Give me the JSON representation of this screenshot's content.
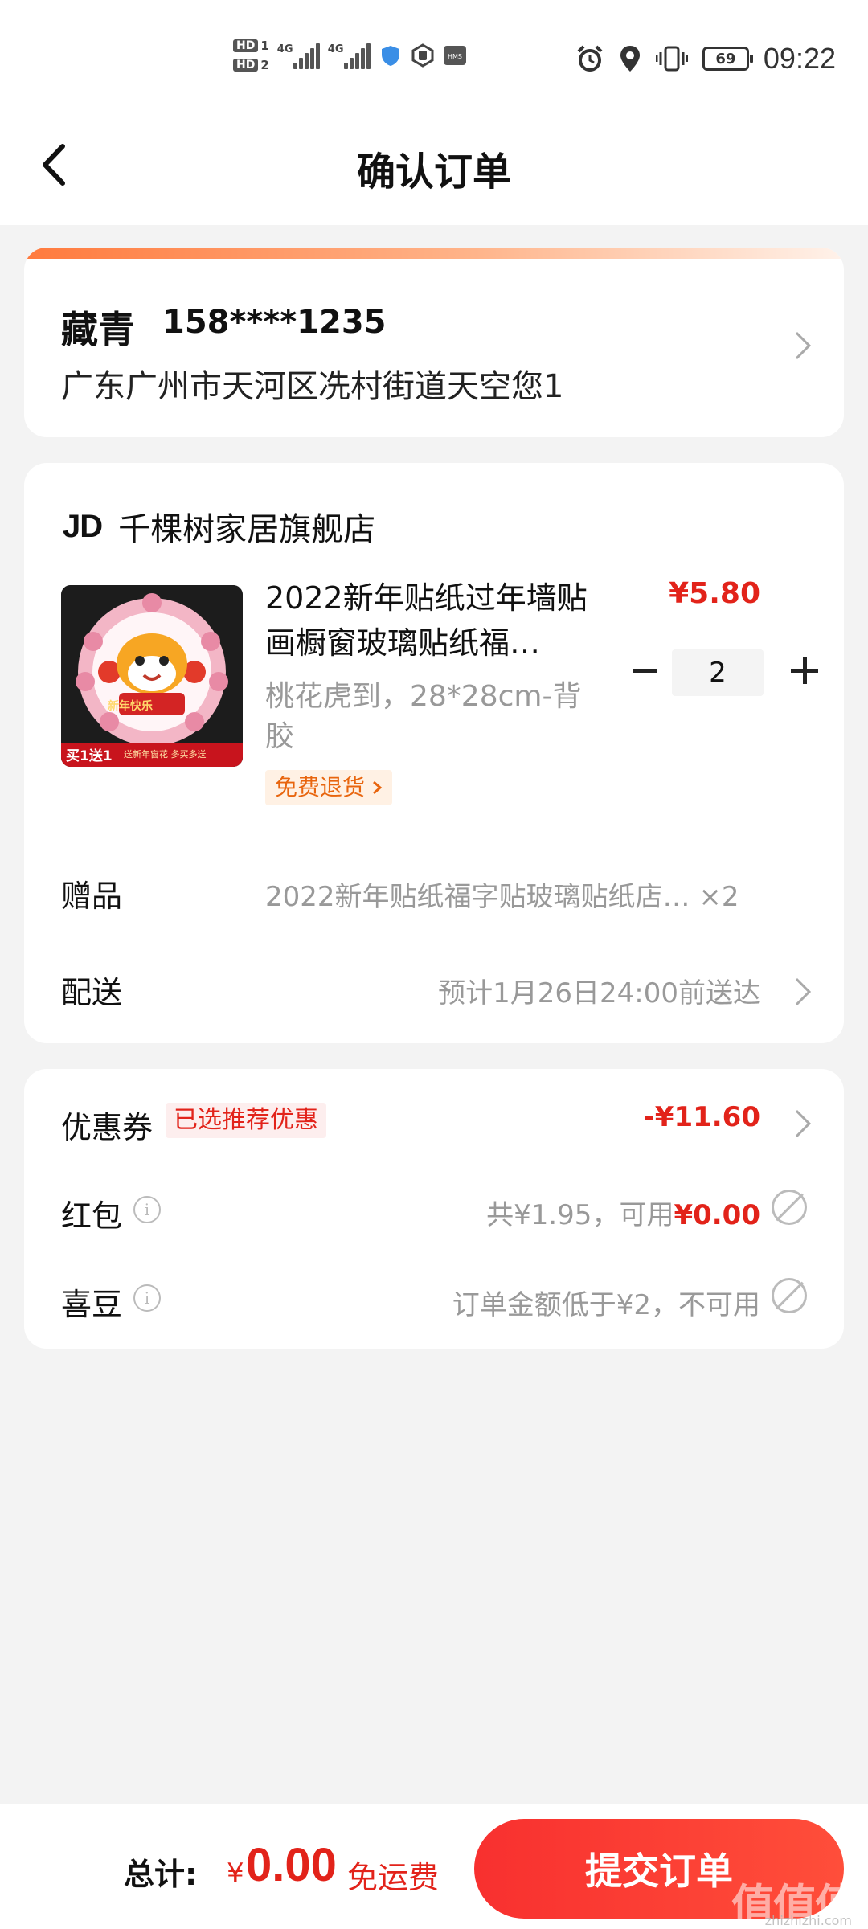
{
  "status_bar": {
    "hd1": "HD",
    "hd1_num": "1",
    "hd2": "HD",
    "hd2_num": "2",
    "net1": "4G",
    "net2": "4G",
    "battery": "69",
    "time": "09:22"
  },
  "nav": {
    "title": "确认订单"
  },
  "address": {
    "name": "藏青",
    "phone": "158****1235",
    "detail": "广东广州市天河区冼村街道天空您1"
  },
  "store": {
    "logo": "JD",
    "name": "千棵树家居旗舰店",
    "product": {
      "image_caption": "新年快乐",
      "image_badge": "买1送1",
      "image_badge2": "送新年窗花 多买多送",
      "title": "2022新年贴纸过年墙贴画橱窗玻璃贴纸福…",
      "spec": "桃花虎到，28*28cm-背胶",
      "return_tag": "免费退货",
      "price": "¥5.80",
      "quantity": "2"
    },
    "gift": {
      "label": "赠品",
      "value": "2022新年贴纸福字贴玻璃贴纸店… ×2"
    },
    "delivery": {
      "label": "配送",
      "value": "预计1月26日24:00前送达"
    }
  },
  "discounts": {
    "coupon": {
      "label": "优惠券",
      "badge": "已选推荐优惠",
      "value": "-¥11.60"
    },
    "red_packet": {
      "label": "红包",
      "prefix": "共¥1.95，可用",
      "available": "¥0.00"
    },
    "beans": {
      "label": "喜豆",
      "value": "订单金额低于¥2，不可用"
    }
  },
  "bottom_bar": {
    "total_label": "总计:",
    "currency": "¥",
    "total": "0.00",
    "shipping": "免运费",
    "submit": "提交订单"
  },
  "watermark": {
    "text": "值值值",
    "sub": "zhizhizhi.com"
  },
  "colors": {
    "accent": "#e2231a",
    "submit": "#f8302f",
    "tag_orange": "#e8650e"
  }
}
